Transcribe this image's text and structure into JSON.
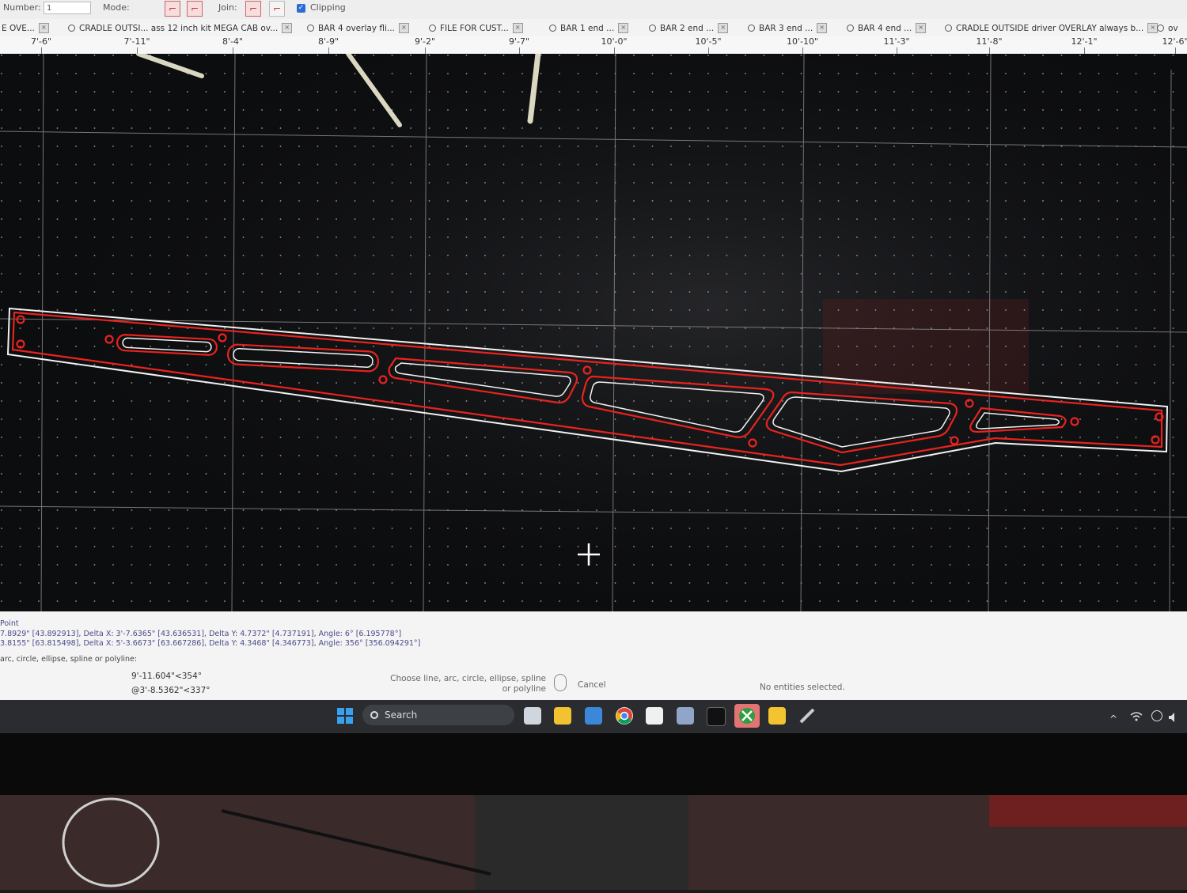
{
  "toolbar": {
    "number_label": "Number:",
    "number_value": "1",
    "mode_label": "Mode:",
    "join_label": "Join:",
    "clipping_label": "Clipping"
  },
  "tabs": [
    {
      "label": "E OVE..."
    },
    {
      "label": "CRADLE OUTSI... ass 12 inch kit MEGA CAB ov..."
    },
    {
      "label": "BAR 4 overlay fli..."
    },
    {
      "label": "FILE FOR CUST..."
    },
    {
      "label": "BAR 1 end ..."
    },
    {
      "label": "BAR 2 end ..."
    },
    {
      "label": "BAR 3 end ..."
    },
    {
      "label": "BAR 4 end ..."
    },
    {
      "label": "CRADLE OUTSIDE driver OVERLAY always b..."
    },
    {
      "label": "ov"
    }
  ],
  "ruler": [
    "7'-6\"",
    "7'-11\"",
    "8'-4\"",
    "8'-9\"",
    "9'-2\"",
    "9'-7\"",
    "10'-0\"",
    "10'-5\"",
    "10'-10\"",
    "11'-3\"",
    "11'-8\"",
    "12'-1\"",
    "12'-6\""
  ],
  "status": {
    "line1": "Point",
    "line2": "7.8929\" [43.892913], Delta X: 3'-7.6365\" [43.636531], Delta Y: 4.7372\" [4.737191], Angle: 6° [6.195778°]",
    "line3": "3.8155\" [63.815498], Delta X: 5'-3.6673\" [63.667286], Delta Y: 4.3468\" [4.346773], Angle: 356° [356.094291°]",
    "command": "arc, circle, ellipse, spline or polyline:",
    "coord1": "9'-11.604\"<354°",
    "coord2": "@3'-8.5362\"<337°",
    "prompt": "Choose line, arc, circle, ellipse, spline or polyline",
    "cancel": "Cancel",
    "selection": "No entities selected."
  },
  "taskbar": {
    "search_label": "Search"
  },
  "colors": {
    "cut_red": "#e8231f",
    "outline_white": "#f2f2f2",
    "canvas_bg": "#0c0d0f",
    "grid": "#8f8f8f"
  }
}
